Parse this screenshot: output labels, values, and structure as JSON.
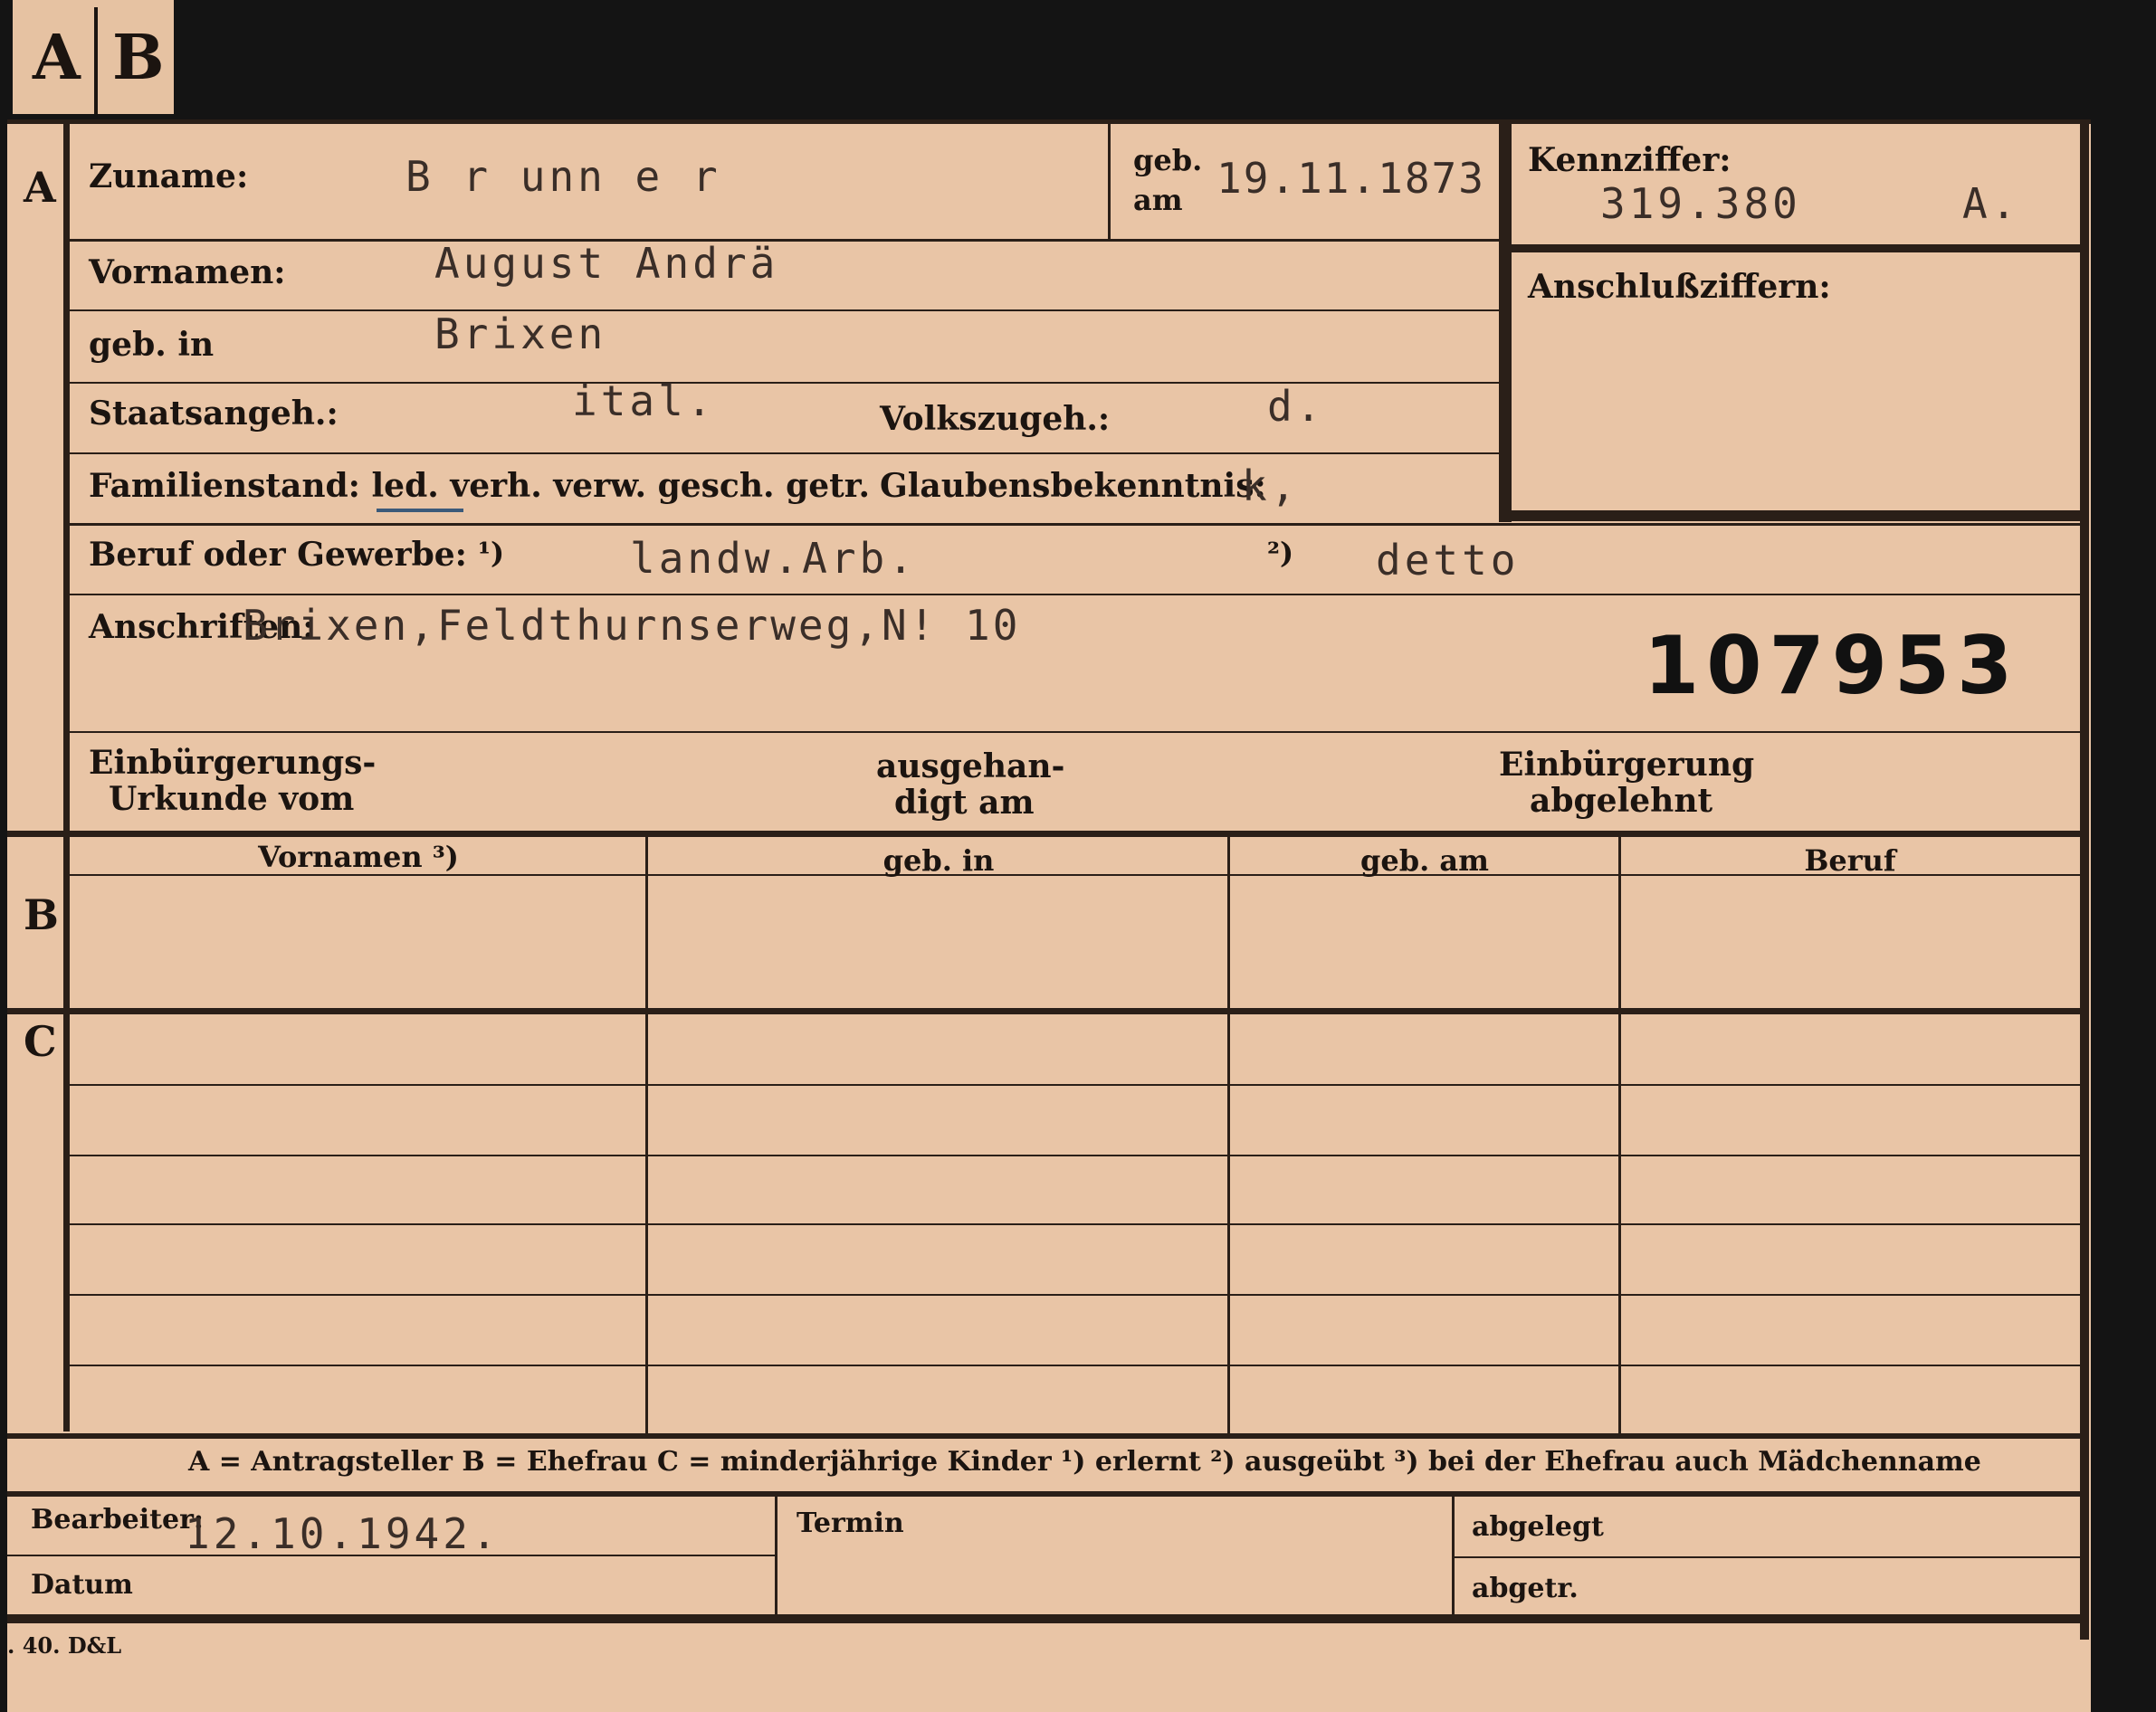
{
  "tabs": {
    "a": "A",
    "b": "B"
  },
  "section_letters": {
    "a": "A",
    "b": "B",
    "c": "C"
  },
  "labels": {
    "zuname": "Zuname:",
    "geb": "geb.",
    "am": "am",
    "kennziffer": "Kennziffer:",
    "anschluss": "Anschlußziffern:",
    "vornamen": "Vornamen:",
    "geb_in": "geb. in",
    "staatsangeh": "Staatsangeh.:",
    "volkszugeh": "Volkszugeh.:",
    "familienstand": "Familienstand: led. verh. verw. gesch. getr.",
    "glaubens": "Glaubensbekenntnis:",
    "beruf": "Beruf oder Gewerbe:",
    "fn1": "¹)",
    "fn2": "²)",
    "anschriften": "Anschriften:",
    "einbuerg_1": "Einbürgerungs-",
    "einbuerg_2": "Urkunde vom",
    "ausgeh_1": "ausgehan-",
    "ausgeh_2": "digt am",
    "abgelehnt_1": "Einbürgerung",
    "abgelehnt_2": "abgelehnt"
  },
  "values": {
    "zuname": "B r unn e r",
    "geb_am": "19.11.1873",
    "kennziffer": "319.380",
    "kennziffer_suffix": "A.",
    "vornamen": "August Andrä",
    "geb_in": "Brixen",
    "staatsangeh": "ital.",
    "volkszugeh": "d.",
    "glaubens": "k,",
    "beruf_erlernt": "landw.Arb.",
    "beruf_ausgeuebt": "detto",
    "anschrift": "Brixen,Feldthurnserweg,N! 10",
    "stamp_number": "107953"
  },
  "table_headers": [
    "Vornamen ³)",
    "geb. in",
    "geb. am",
    "Beruf"
  ],
  "legend": "A = Antragsteller   B = Ehefrau   C = minderjährige Kinder   ¹) erlernt   ²) ausgeübt   ³) bei der Ehefrau auch Mädchenname",
  "footer": {
    "bearbeiter_label": "Bearbeiter:",
    "bearbeiter_value": "12.10.1942.",
    "datum_label": "Datum",
    "termin_label": "Termin",
    "abgelegt_label": "abgelegt",
    "abgetr_label": "abgetr."
  },
  "print_code": ". 40. D&L"
}
